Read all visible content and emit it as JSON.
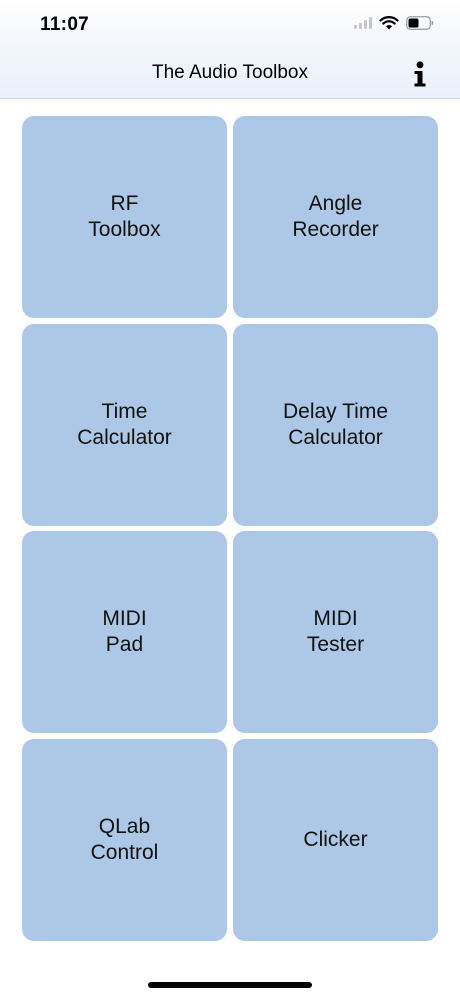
{
  "status_bar": {
    "time": "11:07"
  },
  "nav": {
    "title": "The Audio Toolbox",
    "info_icon": "info-icon"
  },
  "tiles": [
    {
      "label": "RF\nToolbox"
    },
    {
      "label": "Angle\nRecorder"
    },
    {
      "label": "Time\nCalculator"
    },
    {
      "label": "Delay Time\nCalculator"
    },
    {
      "label": "MIDI\nPad"
    },
    {
      "label": "MIDI\nTester"
    },
    {
      "label": "QLab\nControl"
    },
    {
      "label": "Clicker"
    }
  ],
  "colors": {
    "tile_background": "#adc8e6",
    "nav_background": "#e9f1fb"
  }
}
